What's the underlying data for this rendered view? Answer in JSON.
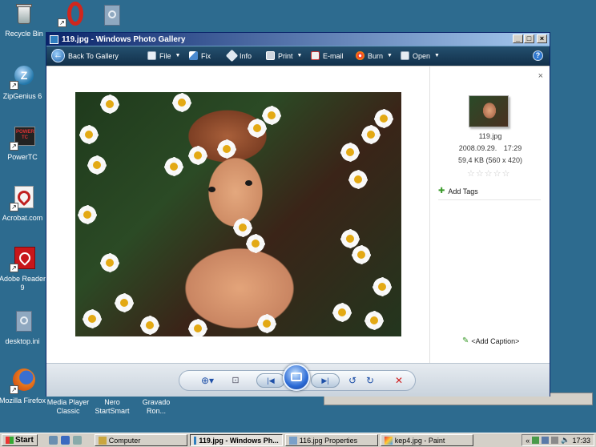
{
  "desktop": {
    "icons": [
      {
        "label": "Recycle Bin",
        "icon": "recycle-bin-icon"
      },
      {
        "label": "ZipGenius 6",
        "icon": "zipgenius-icon"
      },
      {
        "label": "PowerTC",
        "icon": "powertc-icon"
      },
      {
        "label": "Acrobat.com",
        "icon": "acrobat-icon"
      },
      {
        "label": "Adobe Reader 9",
        "icon": "adobe-reader-icon"
      },
      {
        "label": "desktop.ini",
        "icon": "desktop-ini-icon"
      },
      {
        "label": "Mozilla Firefox",
        "icon": "firefox-icon"
      },
      {
        "label": "Media Player Classic",
        "icon": "media-player-icon"
      },
      {
        "label": "Nero StartSmart",
        "icon": "nero-icon"
      },
      {
        "label": "Gravado Ron...",
        "icon": "file-icon"
      }
    ],
    "powertc_text": "POWER\nTC"
  },
  "window": {
    "title": "119.jpg - Windows Photo Gallery",
    "controls": {
      "minimize": "_",
      "maximize": "□",
      "close": "×"
    }
  },
  "cmdbar": {
    "back": "Back To Gallery",
    "file": "File",
    "fix": "Fix",
    "info": "Info",
    "print": "Print",
    "email": "E-mail",
    "burn": "Burn",
    "open": "Open",
    "help": "?"
  },
  "info_pane": {
    "close": "×",
    "filename": "119.jpg",
    "date": "2008.09.29.",
    "time": "17:29",
    "size": "59,4 KB (560 x 420)",
    "rating_stars": "☆☆☆☆☆",
    "rating": 0,
    "rating_max": 5,
    "add_tags": "Add Tags",
    "add_caption": "<Add Caption>"
  },
  "controls": {
    "zoom": "⊕▾",
    "fit": "⊡",
    "prev": "|◀",
    "next": "▶|",
    "rotate_left": "↺",
    "rotate_right": "↻",
    "delete": "✕"
  },
  "taskbar": {
    "start": "Start",
    "tasks": [
      {
        "label": "Computer",
        "active": false
      },
      {
        "label": "119.jpg - Windows Ph...",
        "active": true
      },
      {
        "label": "116.jpg Properties",
        "active": false
      },
      {
        "label": "kep4.jpg - Paint",
        "active": false
      }
    ],
    "tray_chevron": "«",
    "clock": "17:33"
  },
  "colors": {
    "desktop": "#2d6b8f",
    "cmdbar": "#1c3f5c",
    "accent": "#1e50a8"
  }
}
